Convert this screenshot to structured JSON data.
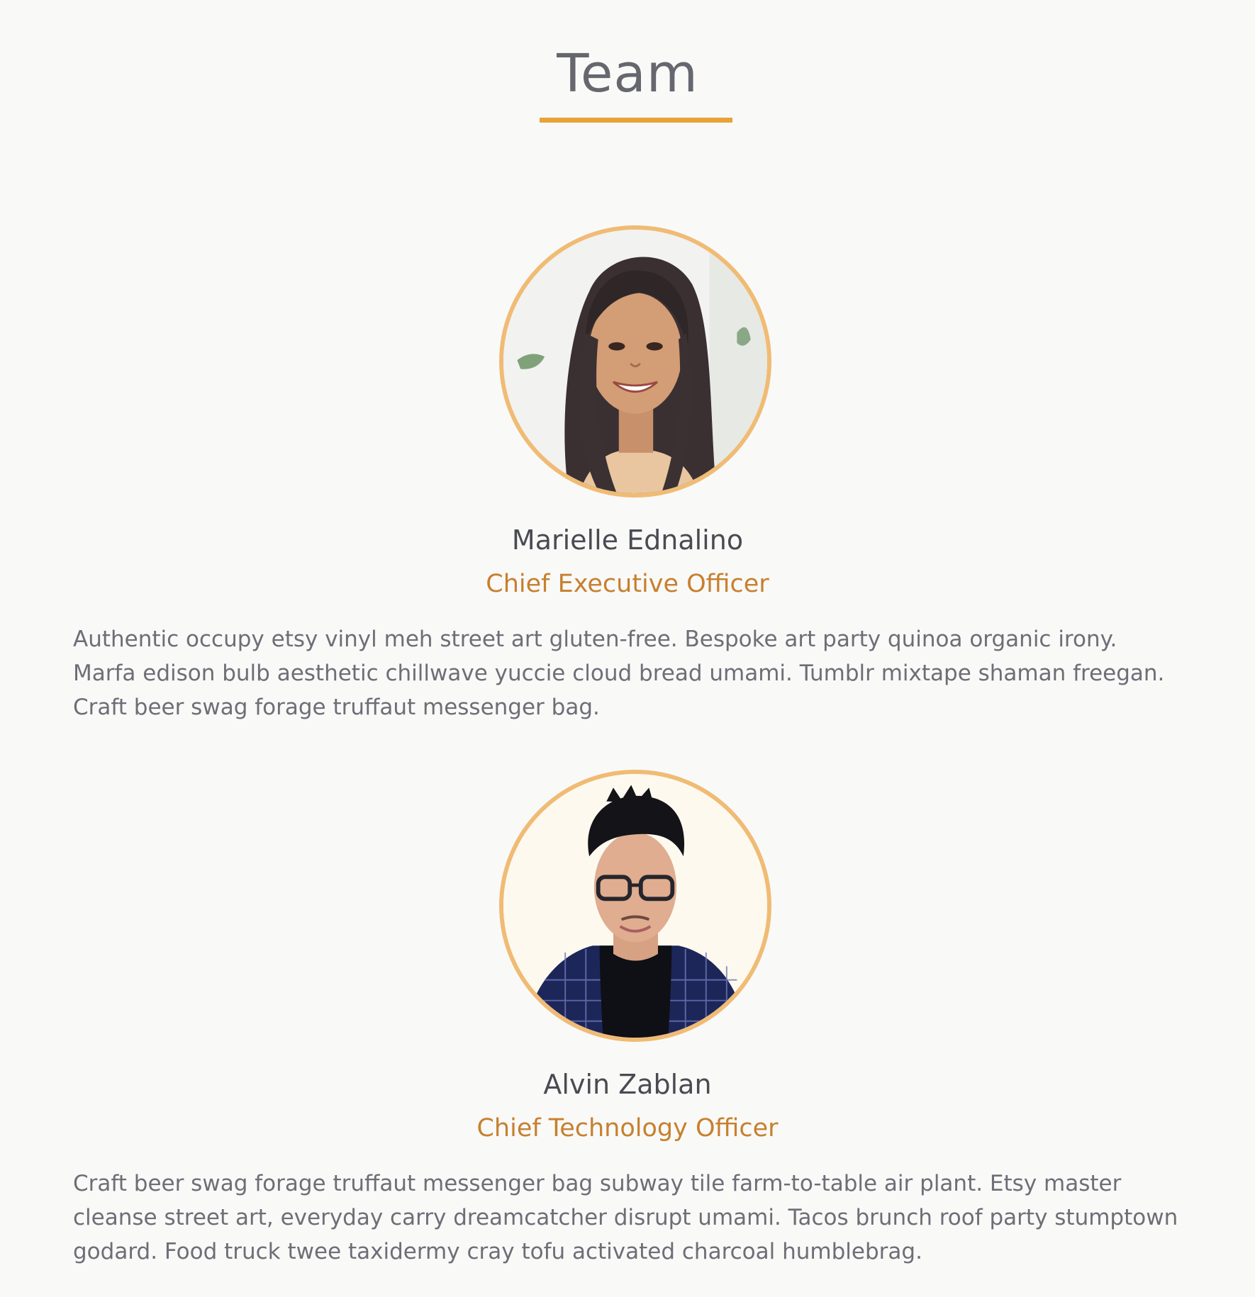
{
  "section": {
    "title": "Team"
  },
  "members": [
    {
      "name": "Marielle Ednalino",
      "role": "Chief Executive Officer",
      "bio": "Authentic occupy etsy vinyl meh street art gluten-free. Bespoke art party quinoa organic irony. Marfa edison bulb aesthetic chillwave yuccie cloud bread umami. Tumblr mixtape shaman freegan. Craft beer swag forage truffaut messenger bag.",
      "photo_icon": "woman-portrait"
    },
    {
      "name": "Alvin Zablan",
      "role": "Chief Technology Officer",
      "bio": "Craft beer swag forage truffaut messenger bag subway tile farm-to-table air plant. Etsy master cleanse street art, everyday carry dreamcatcher disrupt umami. Tacos brunch roof party stumptown godard. Food truck twee taxidermy cray tofu activated charcoal humblebrag.",
      "photo_icon": "man-portrait"
    }
  ],
  "colors": {
    "background": "#f9f9f8",
    "accent": "#e8a338",
    "avatar_border": "#f0bb74",
    "role_text": "#c7802e",
    "title_text": "#66676e",
    "body_text": "#6d6e76"
  }
}
